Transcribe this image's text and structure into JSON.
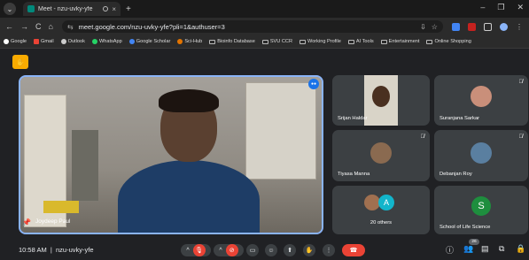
{
  "browser": {
    "tab_title": "Meet - nzu-uvky-yfe",
    "url": "meet.google.com/nzu-uvky-yfe?pli=1&authuser=3",
    "bookmarks": [
      "Google",
      "Gmail",
      "Outlook",
      "WhatsApp",
      "Google Scholar",
      "Sci-Hub",
      "Bioinfo Database",
      "SVU CCR",
      "Working Profile",
      "AI Tools",
      "Entertainment",
      "Online Shopping"
    ]
  },
  "meeting": {
    "main_speaker": "Joydeep Paul",
    "participants": [
      {
        "name": "Srijan Haldar"
      },
      {
        "name": "Suranjana Sarkar"
      },
      {
        "name": "Tiyasa Manna"
      },
      {
        "name": "Debanjan Roy"
      },
      {
        "name": "20 others",
        "avatar_letter": "A"
      },
      {
        "name": "School of Life Science",
        "avatar_letter": "S"
      }
    ],
    "time": "10:58 AM",
    "code": "nzu-uvky-yfe",
    "participant_count_badge": "26"
  },
  "colors": {
    "accent": "#8ab4f8",
    "end_call": "#ea4335",
    "raise_hand": "#f9ab00",
    "avatar_green": "#1e8e3e",
    "avatar_teal": "#12b5cb"
  }
}
